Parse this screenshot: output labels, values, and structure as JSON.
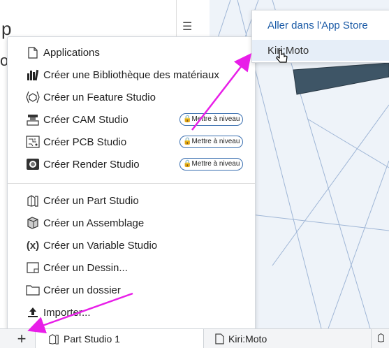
{
  "background": {
    "fragment_top": "p",
    "fragment_bottom": "o"
  },
  "menu": {
    "items": [
      {
        "label": "Applications",
        "icon": "document-icon"
      },
      {
        "label": "Créer une Bibliothèque des matériaux",
        "icon": "materials-library-icon"
      },
      {
        "label": "Créer un Feature Studio",
        "icon": "feature-studio-icon"
      },
      {
        "label": "Créer CAM Studio",
        "icon": "cam-studio-icon",
        "badge": "Mettre à niveau"
      },
      {
        "label": "Créer PCB Studio",
        "icon": "pcb-studio-icon",
        "badge": "Mettre à niveau"
      },
      {
        "label": "Créer Render Studio",
        "icon": "render-studio-icon",
        "badge": "Mettre à niveau"
      },
      {
        "label": "Créer un Part Studio",
        "icon": "part-studio-icon"
      },
      {
        "label": "Créer un Assemblage",
        "icon": "assembly-icon"
      },
      {
        "label": "Créer un Variable Studio",
        "icon": "variable-studio-icon"
      },
      {
        "label": "Créer un Dessin...",
        "icon": "drawing-icon"
      },
      {
        "label": "Créer un dossier",
        "icon": "folder-icon"
      },
      {
        "label": "Importer...",
        "icon": "upload-icon"
      }
    ]
  },
  "submenu": {
    "app_store": "Aller dans l'App Store",
    "kiri": "Kiri:Moto"
  },
  "tabs": [
    {
      "label": "Part Studio 1"
    },
    {
      "label": "Kiri:Moto"
    }
  ],
  "colors": {
    "accent": "#1a5aa6",
    "arrow": "#e81ee8",
    "highlight": "#e6eef8"
  }
}
